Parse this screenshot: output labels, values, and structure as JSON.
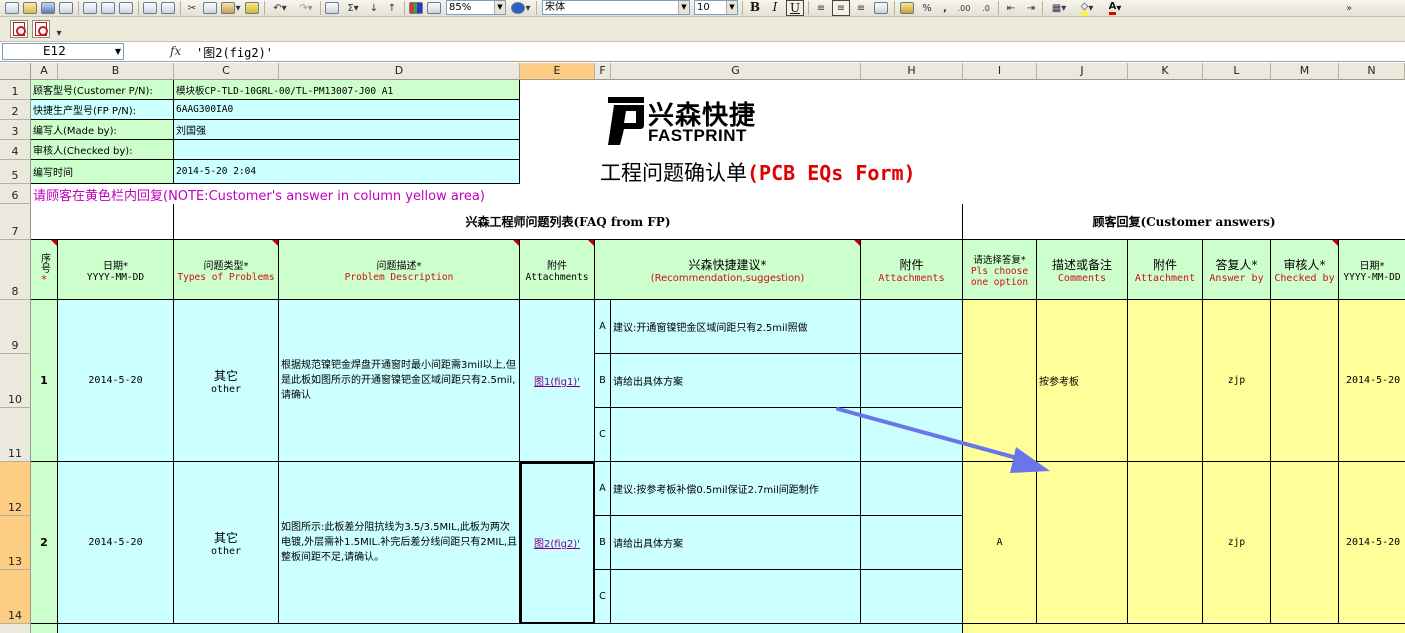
{
  "toolbar": {
    "zoom": "85%",
    "font_name": "宋体",
    "font_size": "10",
    "bold": "B",
    "italic": "I",
    "underline": "U",
    "sum": "Σ",
    "percent": "%",
    "comma": ","
  },
  "formula_bar": {
    "name_box": "E12",
    "fx": "fx",
    "formula": "'图2(fig2)'"
  },
  "columns": [
    "A",
    "B",
    "C",
    "D",
    "E",
    "F",
    "G",
    "H",
    "I",
    "J",
    "K",
    "L",
    "M",
    "N"
  ],
  "selected_column": "E",
  "rows": [
    "1",
    "2",
    "3",
    "4",
    "5",
    "6",
    "7",
    "8",
    "9",
    "10",
    "11",
    "12",
    "13",
    "14"
  ],
  "selected_rows": [
    "12",
    "13",
    "14"
  ],
  "header_block": {
    "customer_pn_label": "顾客型号(Customer P/N):",
    "customer_pn_value": "模块板CP-TLD-10GRL-00/TL-PM13007-J00 A1",
    "fp_pn_label": "快捷生产型号(FP P/N):",
    "fp_pn_value": "6AAG300IA0",
    "made_by_label": "编写人(Made by):",
    "made_by_value": "刘国强",
    "checked_by_label": "审核人(Checked by):",
    "checked_by_value": "",
    "write_time_label": "编写时间",
    "write_time_value": "2014-5-20 2:04",
    "note": "请顾客在黄色栏内回复(NOTE:Customer's answer in column yellow area)"
  },
  "logo": {
    "cn": "兴森快捷",
    "en": "FASTPRINT"
  },
  "form_title": {
    "cn": "工程问题确认单",
    "en": "(PCB EQs Form)"
  },
  "sections": {
    "faq": "兴森工程师问题列表(FAQ from FP)",
    "customer": "顾客回复(Customer answers)"
  },
  "table_headers": {
    "seq": "序号",
    "date": "日期*",
    "date_fmt": "YYYY-MM-DD",
    "type_cn": "问题类型*",
    "type_en": "Types of Problems",
    "desc_cn": "问题描述*",
    "desc_en": "Problem Description",
    "attach_cn": "附件",
    "attach_en": "Attachments",
    "rec_cn": "兴森快捷建议*",
    "rec_en": "(Recommendation,suggestion)",
    "attach2_cn": "附件",
    "attach2_en": "Attachments",
    "choose_cn": "请选择答复*",
    "choose_en": "Pls choose one option",
    "comments_cn": "描述或备注",
    "comments_en": "Comments",
    "attachment_cn": "附件",
    "attachment_en": "Attachment",
    "answer_cn": "答复人*",
    "answer_en": "Answer by",
    "checker_cn": "审核人*",
    "checker_en": "Checked by",
    "date2_cn": "日期*",
    "date2_fmt": "YYYY-MM-DD"
  },
  "issues": [
    {
      "no": "1",
      "date": "2014-5-20",
      "type_cn": "其它",
      "type_en": "other",
      "description": "根据规范镍钯金焊盘开通窗时最小间距需3mil以上,但是此板如图所示的开通窗镍钯金区域间距只有2.5mil,请确认",
      "attachment": "图1(fig1)'",
      "options": [
        {
          "letter": "A",
          "text": "建议:开通窗镍钯金区域间距只有2.5mil照做"
        },
        {
          "letter": "B",
          "text": "请给出具体方案"
        },
        {
          "letter": "C",
          "text": ""
        }
      ],
      "choice": "",
      "comment": "按参考板",
      "answer_by": "zjp",
      "date2": "2014-5-20"
    },
    {
      "no": "2",
      "date": "2014-5-20",
      "type_cn": "其它",
      "type_en": "other",
      "description": "如图所示:此板差分阻抗线为3.5/3.5MIL,此板为两次电镀,外层需补1.5MIL.补完后差分线间距只有2MIL,且整板间距不足,请确认。",
      "attachment": "图2(fig2)'",
      "options": [
        {
          "letter": "A",
          "text": "建议:按参考板补偿0.5mil保证2.7mil间距制作"
        },
        {
          "letter": "B",
          "text": "请给出具体方案"
        },
        {
          "letter": "C",
          "text": ""
        }
      ],
      "choice": "A",
      "comment": "",
      "answer_by": "zjp",
      "date2": "2014-5-20"
    }
  ]
}
